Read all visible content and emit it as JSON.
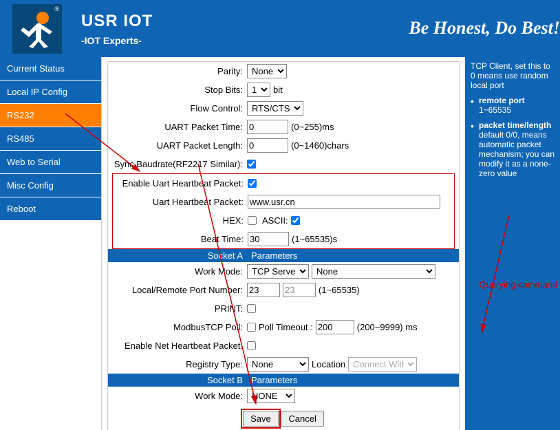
{
  "header": {
    "brand_title": "USR IOT",
    "brand_sub": "-IOT Experts-",
    "slogan": "Be Honest, Do Best!"
  },
  "sidebar": {
    "items": [
      {
        "label": "Current Status"
      },
      {
        "label": "Local IP Config"
      },
      {
        "label": "RS232"
      },
      {
        "label": "RS485"
      },
      {
        "label": "Web to Serial"
      },
      {
        "label": "Misc Config"
      },
      {
        "label": "Reboot"
      }
    ]
  },
  "form": {
    "parity_label": "Parity:",
    "parity_value": "None",
    "stopbits_label": "Stop Bits:",
    "stopbits_value": "1",
    "stopbits_suffix": "bit",
    "flowctrl_label": "Flow Control:",
    "flowctrl_value": "RTS/CTS",
    "uart_pkt_time_label": "UART Packet Time:",
    "uart_pkt_time_value": "0",
    "uart_pkt_time_hint": "(0~255)ms",
    "uart_pkt_len_label": "UART Packet Length:",
    "uart_pkt_len_value": "0",
    "uart_pkt_len_hint": "(0~1460)chars",
    "sync_label": "Sync Baudrate(RF2217 Similar):",
    "enable_hb_label": "Enable Uart Heartbeat Packet:",
    "hb_pkt_label": "Uart Heartbeat Packet:",
    "hb_pkt_value": "www.usr.cn",
    "hex_label": "HEX:",
    "ascii_label": "ASCII:",
    "beat_time_label": "Beat Time:",
    "beat_time_value": "30",
    "beat_time_hint": "(1~65535)s",
    "socket_a_head_l": "Socket A",
    "socket_a_head_r": "Parameters",
    "work_mode_a_label": "Work Mode:",
    "work_mode_a_value": "TCP Server",
    "work_mode_a_sub": "None",
    "port_label": "Local/Remote Port Number:",
    "port_local": "23",
    "port_remote": "23",
    "port_hint": "(1~65535)",
    "print_label": "PRINT:",
    "modbus_label": "ModbusTCP Poll:",
    "poll_timeout_label": "Poll Timeout :",
    "poll_timeout_value": "200",
    "poll_timeout_hint": "(200~9999) ms",
    "enable_net_hb_label": "Enable Net Heartbeat Packet:",
    "regtype_label": "Registry Type:",
    "regtype_value": "None",
    "location_label": "Location",
    "location_value": "Connect With",
    "socket_b_head_l": "Socket B",
    "socket_b_head_r": "Parameters",
    "work_mode_b_label": "Work Mode:",
    "work_mode_b_value": "NONE",
    "save_label": "Save",
    "cancel_label": "Cancel"
  },
  "rcol": {
    "pre": "TCP Client, set this to 0 means use random local port",
    "item1_b": "remote port",
    "item1_t": "1~65535",
    "item2_b": "packet time/length",
    "item2_t": "default 0/0, means automatic packet mechanism; you can modify it as a none-zero value"
  },
  "annot": {
    "querying": "Querying command"
  }
}
